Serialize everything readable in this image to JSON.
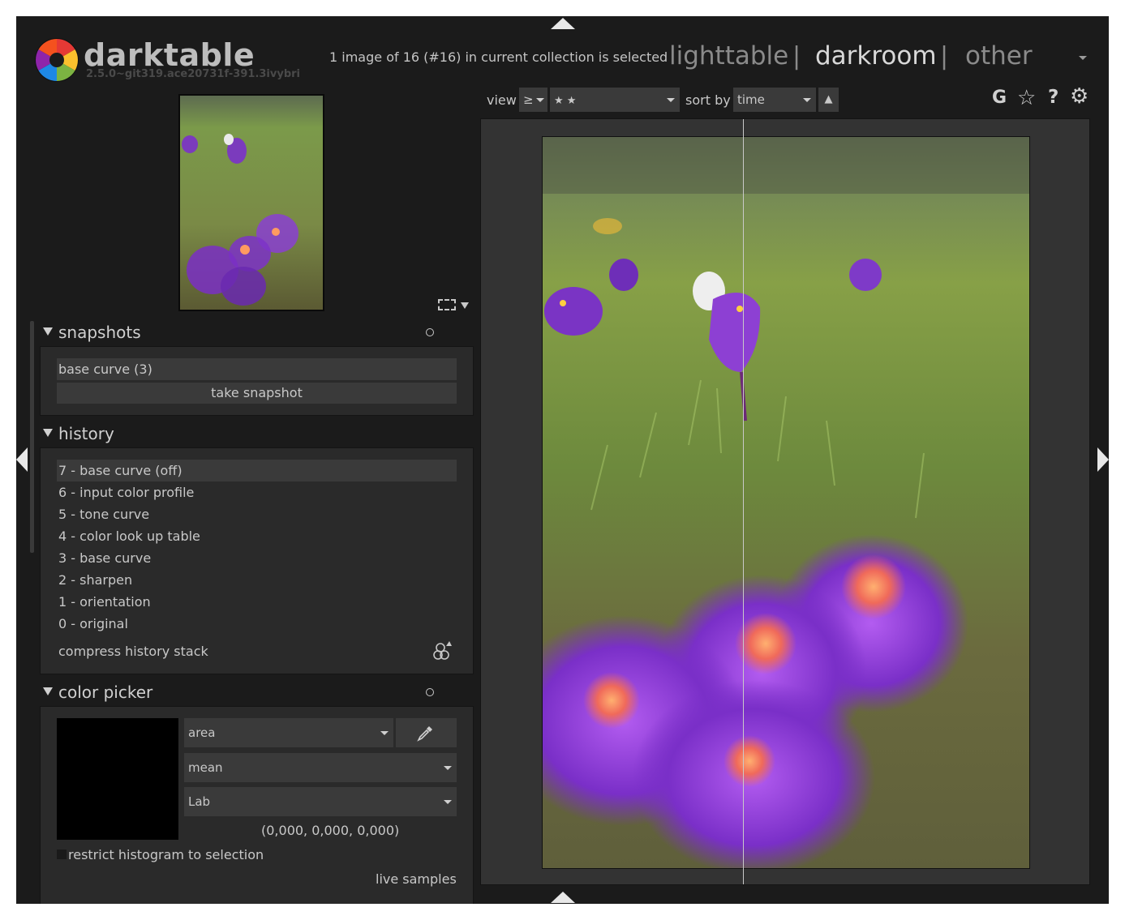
{
  "app": {
    "name": "darktable",
    "version": "2.5.0~git319.ace20731f-391.3ivybri",
    "status": "1 image of 16 (#16) in current collection is selected"
  },
  "views": {
    "lighttable": "lighttable",
    "darkroom": "darkroom",
    "other": "other",
    "separator": "|",
    "active": "darkroom"
  },
  "toolbar": {
    "view_label": "view",
    "rating_operator": "≥",
    "rating_value": "★ ★",
    "sort_label": "sort by",
    "sort_value": "time",
    "icons": [
      "grouping-icon",
      "star-icon",
      "help-icon",
      "gear-icon"
    ],
    "grouping_glyph": "G",
    "star_glyph": "☆",
    "help_glyph": "?",
    "gear_glyph": "⚙",
    "sort_dir_glyph": "▲"
  },
  "snapshots": {
    "title": "snapshots",
    "items": [
      "base curve (3)"
    ],
    "take_button": "take snapshot"
  },
  "history": {
    "title": "history",
    "items": [
      "7 - base curve  (off)",
      "6 - input color profile",
      "5 - tone curve",
      "4 - color look up table",
      "3 - base curve",
      "2 - sharpen",
      "1 - orientation",
      "0 - original"
    ],
    "selected_index": 0,
    "compress_label": "compress history stack"
  },
  "color_picker": {
    "title": "color picker",
    "mode": "area",
    "statistic": "mean",
    "color_space": "Lab",
    "values": "(0,000, 0,000, 0,000)",
    "restrict_label": "restrict histogram to selection",
    "restrict_checked": false,
    "live_samples_label": "live samples",
    "swatch_color": "#000000"
  },
  "colors": {
    "background": "#1b1b1b",
    "panel": "#2a2a2a",
    "center": "#333333",
    "widget": "#3a3a3a",
    "text": "#c8c8c8"
  }
}
